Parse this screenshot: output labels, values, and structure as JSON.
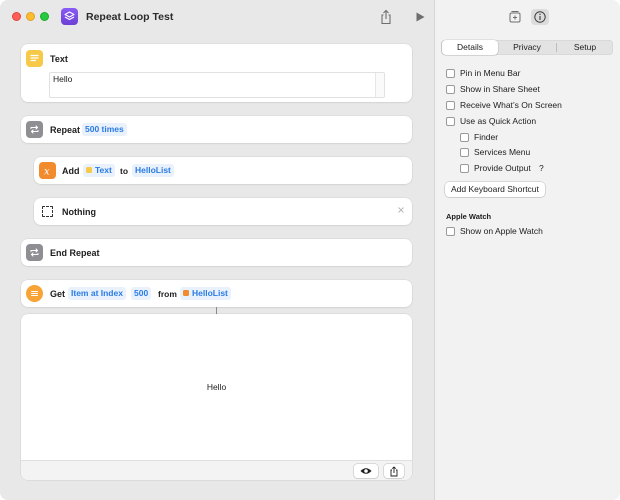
{
  "window": {
    "title": "Repeat Loop Test"
  },
  "actions": {
    "text": {
      "label": "Text",
      "value": "Hello"
    },
    "repeat": {
      "label": "Repeat",
      "count": "500 times"
    },
    "add": {
      "label": "Add",
      "item": "Text",
      "to": "to",
      "list": "HelloList"
    },
    "nothing": {
      "label": "Nothing"
    },
    "end_repeat": {
      "label": "End Repeat"
    },
    "get": {
      "label": "Get",
      "item_at_index": "Item at Index",
      "index": "500",
      "from": "from",
      "list": "HelloList"
    }
  },
  "result": {
    "text": "Hello"
  },
  "inspector": {
    "tabs": [
      "Details",
      "Privacy",
      "Setup"
    ],
    "selected_tab": "Details",
    "options": [
      {
        "label": "Pin in Menu Bar",
        "checked": false
      },
      {
        "label": "Show in Share Sheet",
        "checked": false
      },
      {
        "label": "Receive What’s On Screen",
        "checked": false
      },
      {
        "label": "Use as Quick Action",
        "checked": false
      }
    ],
    "quick_action_options": [
      {
        "label": "Finder",
        "checked": false
      },
      {
        "label": "Services Menu",
        "checked": false
      },
      {
        "label": "Provide Output",
        "checked": false
      }
    ],
    "help_mark": "?",
    "keyboard_button": "Add Keyboard Shortcut",
    "apple_watch_header": "Apple Watch",
    "apple_watch_option": {
      "label": "Show on Apple Watch",
      "checked": false
    }
  },
  "colors": {
    "accent_blue": "#2a7be4",
    "text_icon": "#f7c948",
    "repeat_icon": "#8e8e93",
    "variable_icon": "#f28a2e",
    "list_icon": "#f7a335",
    "shortcuts_purple": "#7a4ee6"
  }
}
